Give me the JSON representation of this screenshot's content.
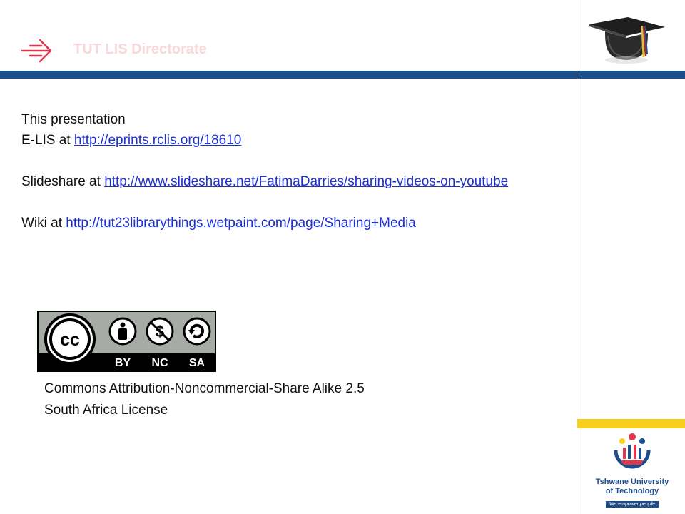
{
  "header": {
    "title": "TUT LIS Directorate",
    "icon": "arrow-right-icon",
    "bar_color": "#1d4e8c"
  },
  "content": {
    "intro": "This presentation",
    "eprints_prefix": "E-LIS at ",
    "eprints_link": "http://eprints.rclis.org/18610",
    "slideshare_prefix": "Slideshare at ",
    "slideshare_link": "http://www.slideshare.net/FatimaDarries/sharing-videos-on-youtube",
    "wiki_prefix": "Wiki at ",
    "wiki_link": "http://tut23librarythings.wetpaint.com/page/Sharing+Media",
    "link_color": "#1c2fd2"
  },
  "license": {
    "badge_labels": [
      "BY",
      "NC",
      "SA"
    ],
    "badge_icon": "creative-commons-icon",
    "line1": "Commons Attribution-Noncommercial-Share Alike 2.5",
    "line2": "South Africa License"
  },
  "logo": {
    "name_line1": "Tshwane University",
    "name_line2": "of Technology",
    "tagline": "We empower people",
    "accent_yellow": "#f7cf1c"
  }
}
